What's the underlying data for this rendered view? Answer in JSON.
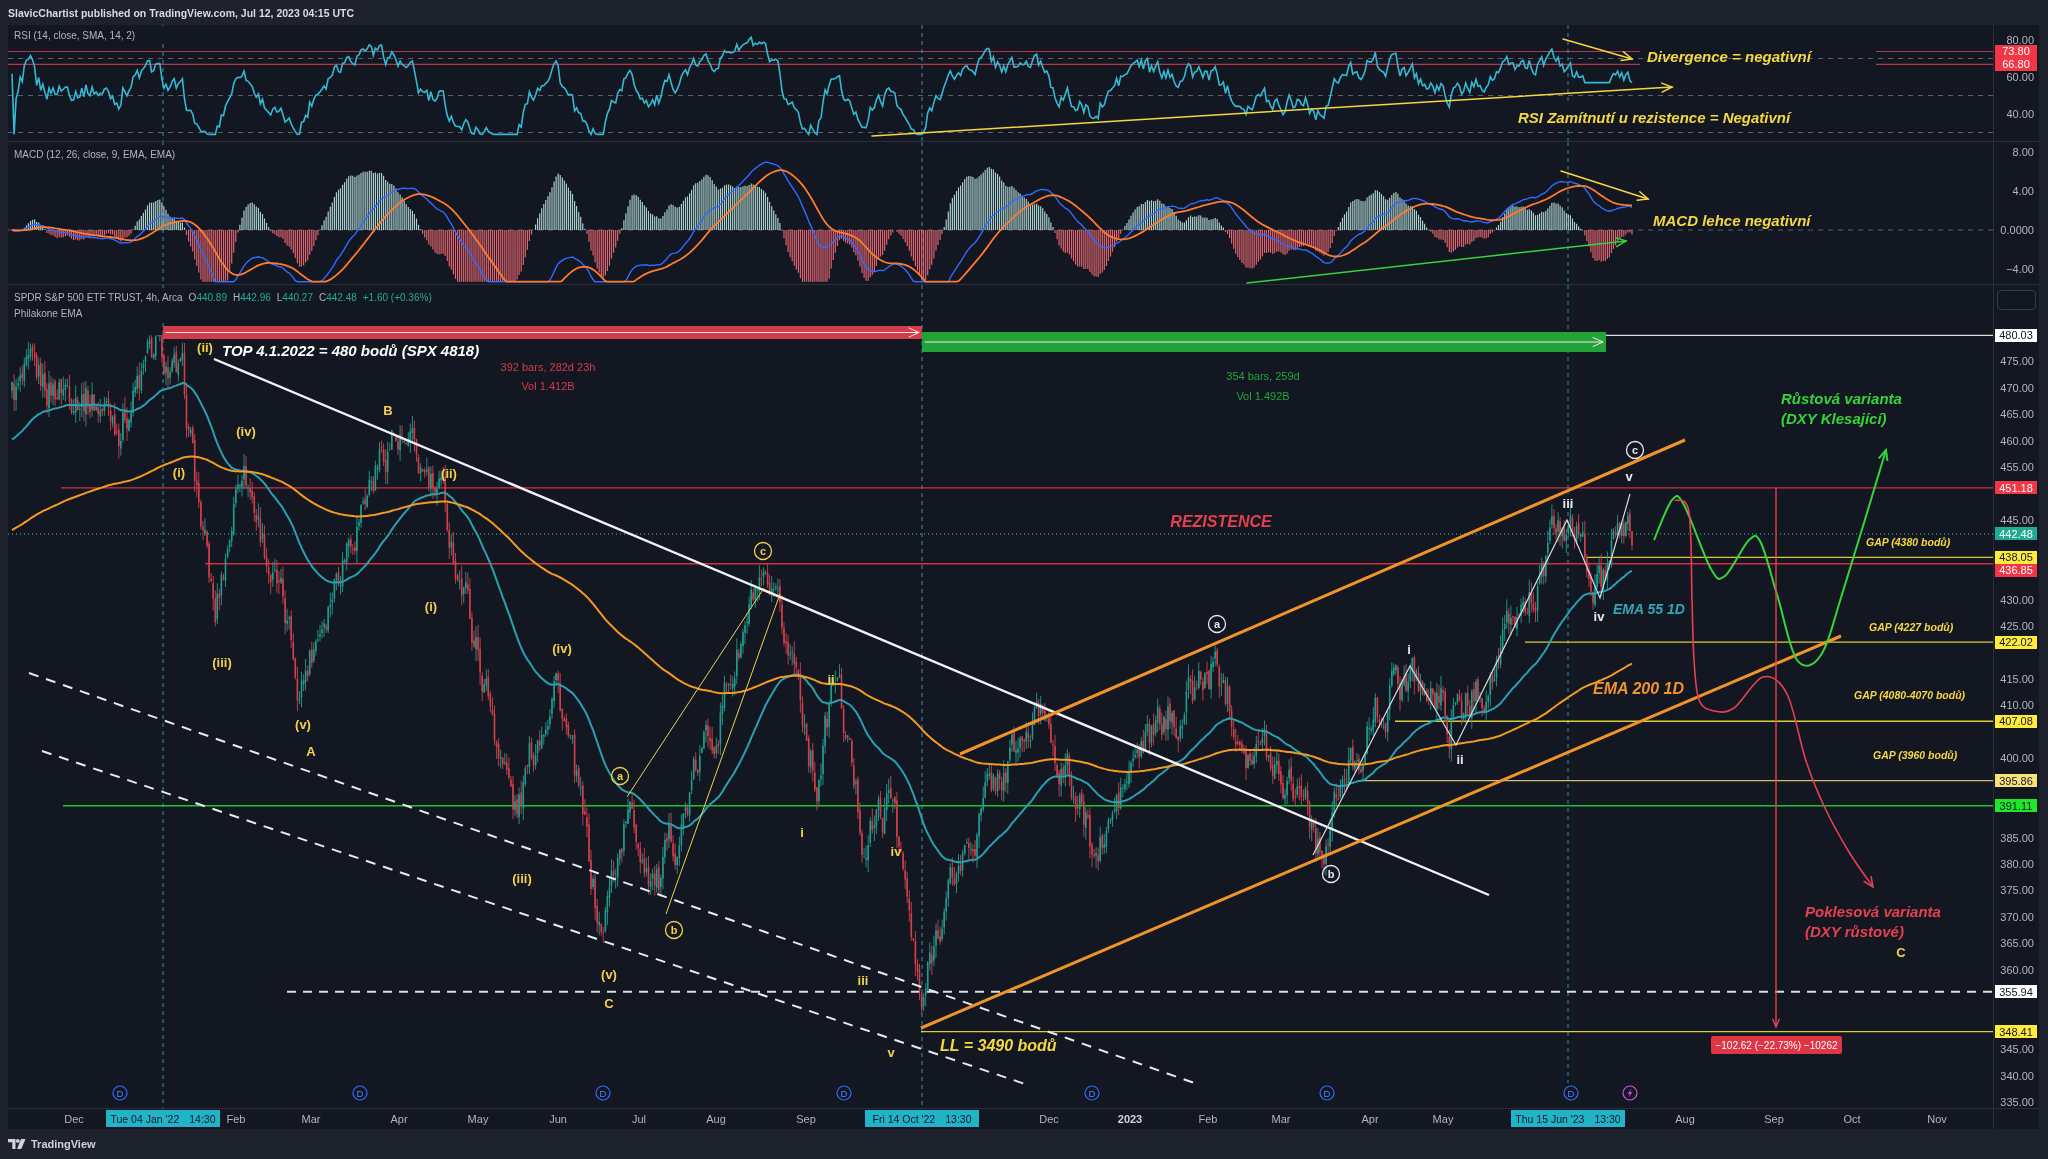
{
  "header": {
    "caption": "SlavicChartist published on TradingView.com, Jul 12, 2023 04:15 UTC"
  },
  "rsi_pane": {
    "legend": "RSI (14, close, SMA, 14, 2)",
    "axis_ticks": [
      "80.00",
      "60.00",
      "40.00"
    ],
    "price_badges": [
      {
        "text": "73.80",
        "color": "#f23645"
      },
      {
        "text": "66.80",
        "color": "#f23645"
      }
    ],
    "annotations": [
      {
        "text": "Divergence = negativní",
        "color": "#f5d742"
      },
      {
        "text": "RSI Zamítnutí u rezistence = Negativní",
        "color": "#f5d742"
      }
    ]
  },
  "macd_pane": {
    "legend": "MACD (12, 26, close, 9, EMA, EMA)",
    "axis_ticks": [
      "8.00",
      "4.00",
      "0.0000",
      "−4.00"
    ],
    "annotations": [
      {
        "text": "MACD lehce negativní",
        "color": "#f5d742"
      }
    ]
  },
  "price_pane": {
    "symbol": "SPDR S&P 500 ETF TRUST, 4h, Arca",
    "ohlc": [
      {
        "letter": "O",
        "value": "440.89"
      },
      {
        "letter": "H",
        "value": "442.96"
      },
      {
        "letter": "L",
        "value": "440.27"
      },
      {
        "letter": "C",
        "value": "442.48"
      }
    ],
    "change": "+1.60 (+0.36%)",
    "indicator": "Philakone EMA",
    "axis_ticks": [
      "475.00",
      "470.00",
      "465.00",
      "460.00",
      "455.00",
      "445.00",
      "430.00",
      "425.00",
      "415.00",
      "410.00",
      "400.00",
      "385.00",
      "380.00",
      "375.00",
      "370.00",
      "365.00",
      "360.00",
      "345.00",
      "340.00",
      "335.00"
    ],
    "price_badges": [
      {
        "text": "480.03",
        "color": "#ffffff"
      },
      {
        "text": "451.18",
        "color": "#f23645"
      },
      {
        "text": "442.48",
        "color": "#22ab94"
      },
      {
        "text": "438.05",
        "color": "#ffeb3b"
      },
      {
        "text": "436.85",
        "color": "#f23645"
      },
      {
        "text": "422.02",
        "color": "#ffeb3b"
      },
      {
        "text": "407.08",
        "color": "#ffeb3b"
      },
      {
        "text": "395.86",
        "color": "#f5e27a"
      },
      {
        "text": "391.11",
        "color": "#1ee82a"
      },
      {
        "text": "355.94",
        "color": "#ffffff"
      },
      {
        "text": "348.41",
        "color": "#ffeb3b"
      }
    ],
    "date_ranges": [
      {
        "bars": "392 bars, 282d 23h",
        "volume": "Vol 1.412B",
        "color": "#d23c4b"
      },
      {
        "bars": "354 bars, 259d",
        "volume": "Vol 1.492B",
        "color": "#22a33a"
      }
    ],
    "annotations": [
      {
        "text": "TOP 4.1.2022 = 480 bodů (SPX 4818)",
        "color": "#ffffff"
      },
      {
        "text": "REZISTENCE",
        "color": "#e5404f"
      },
      {
        "text": "EMA 55 1D",
        "color": "#2fa8b5"
      },
      {
        "text": "EMA 200 1D",
        "color": "#f0932b"
      },
      {
        "text": "LL = 3490 bodů",
        "color": "#f5d742"
      },
      {
        "text": "GAP (4380 bodů)",
        "color": "#f5d742"
      },
      {
        "text": "GAP (4227 bodů)",
        "color": "#f5d742"
      },
      {
        "text": "GAP (4080-4070 bodů)",
        "color": "#f5d742"
      },
      {
        "text": "GAP (3960 bodů)",
        "color": "#f5d742"
      },
      {
        "text": "Růstová varianta",
        "color": "#36d43b"
      },
      {
        "text": "(DXY Klesající)",
        "color": "#36d43b"
      },
      {
        "text": "Poklesová varianta",
        "color": "#e5404f"
      },
      {
        "text": "(DXY růstové)",
        "color": "#e5404f"
      }
    ],
    "wave_labels": [
      {
        "text": "(ii)",
        "circled": false,
        "color": "#f2d14b"
      },
      {
        "text": "(i)",
        "circled": false,
        "color": "#f2d14b"
      },
      {
        "text": "(iv)",
        "circled": false,
        "color": "#f2d14b"
      },
      {
        "text": "(iii)",
        "circled": false,
        "color": "#f2d14b"
      },
      {
        "text": "(v)",
        "circled": false,
        "color": "#f2d14b"
      },
      {
        "text": "A",
        "circled": false,
        "color": "#f2d14b"
      },
      {
        "text": "B",
        "circled": false,
        "color": "#f2d14b"
      },
      {
        "text": "(ii)",
        "circled": false,
        "color": "#f2d14b"
      },
      {
        "text": "(i)",
        "circled": false,
        "color": "#f2d14b"
      },
      {
        "text": "(iv)",
        "circled": false,
        "color": "#f2d14b"
      },
      {
        "text": "(iii)",
        "circled": false,
        "color": "#f2d14b"
      },
      {
        "text": "(v)",
        "circled": false,
        "color": "#f2d14b"
      },
      {
        "text": "C",
        "circled": false,
        "color": "#f2d14b"
      },
      {
        "text": "a",
        "circled": true,
        "color": "#f2d14b"
      },
      {
        "text": "b",
        "circled": true,
        "color": "#f2d14b"
      },
      {
        "text": "c",
        "circled": true,
        "color": "#f2d14b"
      },
      {
        "text": "ii",
        "circled": false,
        "color": "#f2d14b"
      },
      {
        "text": "i",
        "circled": false,
        "color": "#f2d14b"
      },
      {
        "text": "iv",
        "circled": false,
        "color": "#f2d14b"
      },
      {
        "text": "iii",
        "circled": false,
        "color": "#f2d14b"
      },
      {
        "text": "v",
        "circled": false,
        "color": "#f2d14b"
      },
      {
        "text": "a",
        "circled": true,
        "color": "#e6e8ee"
      },
      {
        "text": "b",
        "circled": true,
        "color": "#e6e8ee"
      },
      {
        "text": "i",
        "circled": false,
        "color": "#e6e8ee"
      },
      {
        "text": "ii",
        "circled": false,
        "color": "#e6e8ee"
      },
      {
        "text": "iii",
        "circled": false,
        "color": "#e6e8ee"
      },
      {
        "text": "iv",
        "circled": false,
        "color": "#e6e8ee"
      },
      {
        "text": "v",
        "circled": false,
        "color": "#e6e8ee"
      },
      {
        "text": "c",
        "circled": true,
        "color": "#e6e8ee"
      },
      {
        "text": "C",
        "circled": false,
        "color": "#f2d14b"
      }
    ],
    "measurement": "−102.62 (−22.73%) −10262",
    "event_markers": [
      {
        "kind": "letter",
        "text": "D"
      },
      {
        "kind": "letter",
        "text": "D"
      },
      {
        "kind": "letter",
        "text": "D"
      },
      {
        "kind": "letter",
        "text": "D"
      },
      {
        "kind": "letter",
        "text": "D"
      },
      {
        "kind": "letter",
        "text": "D"
      },
      {
        "kind": "letter",
        "text": "D"
      },
      {
        "kind": "icon"
      }
    ]
  },
  "time_axis": {
    "ticks": [
      {
        "text": "Dec",
        "kind": "month"
      },
      {
        "text": "Feb",
        "kind": "month"
      },
      {
        "text": "Mar",
        "kind": "month"
      },
      {
        "text": "Apr",
        "kind": "month"
      },
      {
        "text": "May",
        "kind": "month"
      },
      {
        "text": "Jun",
        "kind": "month"
      },
      {
        "text": "Jul",
        "kind": "month"
      },
      {
        "text": "Aug",
        "kind": "month"
      },
      {
        "text": "Sep",
        "kind": "month"
      },
      {
        "text": "Dec",
        "kind": "month"
      },
      {
        "text": "2023",
        "kind": "year"
      },
      {
        "text": "Feb",
        "kind": "month"
      },
      {
        "text": "Mar",
        "kind": "month"
      },
      {
        "text": "Apr",
        "kind": "month"
      },
      {
        "text": "May",
        "kind": "month"
      },
      {
        "text": "Aug",
        "kind": "month"
      },
      {
        "text": "Sep",
        "kind": "month"
      },
      {
        "text": "Oct",
        "kind": "month"
      },
      {
        "text": "Nov",
        "kind": "month"
      }
    ],
    "crosshair_labels": [
      {
        "date": "Tue 04 Jan '22",
        "time": "14:30"
      },
      {
        "date": "Fri 14 Oct '22",
        "time": "13:30"
      },
      {
        "date": "Thu 15 Jun '23",
        "time": "13:30"
      }
    ]
  },
  "footer": {
    "brand": "TradingView"
  }
}
